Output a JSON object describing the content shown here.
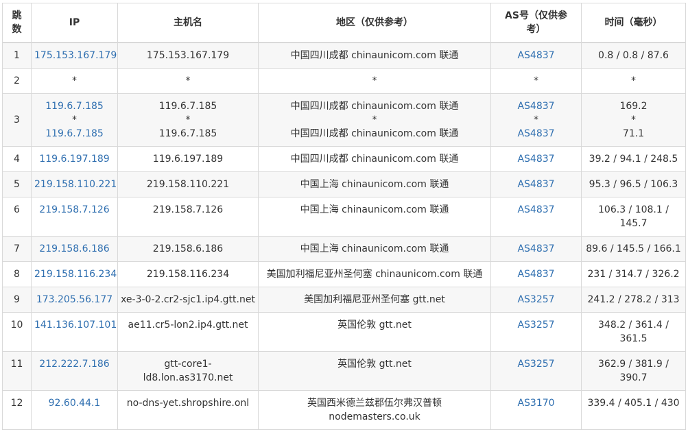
{
  "headers": {
    "hop": "跳数",
    "ip": "IP",
    "host": "主机名",
    "region": "地区（仅供参考）",
    "as": "AS号（仅供参考）",
    "time": "时间（毫秒）"
  },
  "rows": [
    {
      "hop": "1",
      "ip": [
        "175.153.167.179"
      ],
      "host": [
        "175.153.167.179"
      ],
      "region": [
        "中国四川成都 chinaunicom.com 联通"
      ],
      "as": [
        "AS4837"
      ],
      "time": [
        "0.8 / 0.8 / 87.6"
      ]
    },
    {
      "hop": "2",
      "ip": [
        "*"
      ],
      "host": [
        "*"
      ],
      "region": [
        "*"
      ],
      "as": [
        "*"
      ],
      "time": [
        "*"
      ]
    },
    {
      "hop": "3",
      "ip": [
        "119.6.7.185",
        "*",
        "119.6.7.185"
      ],
      "host": [
        "119.6.7.185",
        "*",
        "119.6.7.185"
      ],
      "region": [
        "中国四川成都 chinaunicom.com 联通",
        "*",
        "中国四川成都 chinaunicom.com 联通"
      ],
      "as": [
        "AS4837",
        "*",
        "AS4837"
      ],
      "time": [
        "169.2",
        "*",
        "71.1"
      ]
    },
    {
      "hop": "4",
      "ip": [
        "119.6.197.189"
      ],
      "host": [
        "119.6.197.189"
      ],
      "region": [
        "中国四川成都 chinaunicom.com 联通"
      ],
      "as": [
        "AS4837"
      ],
      "time": [
        "39.2 / 94.1 / 248.5"
      ]
    },
    {
      "hop": "5",
      "ip": [
        "219.158.110.221"
      ],
      "host": [
        "219.158.110.221"
      ],
      "region": [
        "中国上海 chinaunicom.com 联通"
      ],
      "as": [
        "AS4837"
      ],
      "time": [
        "95.3 / 96.5 / 106.3"
      ]
    },
    {
      "hop": "6",
      "ip": [
        "219.158.7.126"
      ],
      "host": [
        "219.158.7.126"
      ],
      "region": [
        "中国上海 chinaunicom.com 联通"
      ],
      "as": [
        "AS4837"
      ],
      "time": [
        "106.3 / 108.1 /",
        "145.7"
      ]
    },
    {
      "hop": "7",
      "ip": [
        "219.158.6.186"
      ],
      "host": [
        "219.158.6.186"
      ],
      "region": [
        "中国上海 chinaunicom.com 联通"
      ],
      "as": [
        "AS4837"
      ],
      "time": [
        "89.6 / 145.5 / 166.1"
      ]
    },
    {
      "hop": "8",
      "ip": [
        "219.158.116.234"
      ],
      "host": [
        "219.158.116.234"
      ],
      "region": [
        "美国加利福尼亚州圣何塞 chinaunicom.com 联通"
      ],
      "as": [
        "AS4837"
      ],
      "time": [
        "231 / 314.7 / 326.2"
      ]
    },
    {
      "hop": "9",
      "ip": [
        "173.205.56.177"
      ],
      "host": [
        "xe-3-0-2.cr2-sjc1.ip4.gtt.net"
      ],
      "region": [
        "美国加利福尼亚州圣何塞 gtt.net"
      ],
      "as": [
        "AS3257"
      ],
      "time": [
        "241.2 / 278.2 / 313"
      ]
    },
    {
      "hop": "10",
      "ip": [
        "141.136.107.101"
      ],
      "host": [
        "ae11.cr5-lon2.ip4.gtt.net"
      ],
      "region": [
        "英国伦敦 gtt.net"
      ],
      "as": [
        "AS3257"
      ],
      "time": [
        "348.2 / 361.4 /",
        "361.5"
      ]
    },
    {
      "hop": "11",
      "ip": [
        "212.222.7.186"
      ],
      "host": [
        "gtt-core1-",
        "ld8.lon.as3170.net"
      ],
      "region": [
        "英国伦敦 gtt.net"
      ],
      "as": [
        "AS3257"
      ],
      "time": [
        "362.9 / 381.9 /",
        "390.7"
      ]
    },
    {
      "hop": "12",
      "ip": [
        "92.60.44.1"
      ],
      "host": [
        "no-dns-yet.shropshire.onl"
      ],
      "region": [
        "英国西米德兰兹郡伍尔弗汉普顿",
        "nodemasters.co.uk"
      ],
      "as": [
        "AS3170"
      ],
      "time": [
        "339.4 / 405.1 / 430"
      ]
    }
  ],
  "colors": {
    "link": "#2f6fb0",
    "stripe": "#f7f7f7",
    "border": "#d9d9d9"
  }
}
